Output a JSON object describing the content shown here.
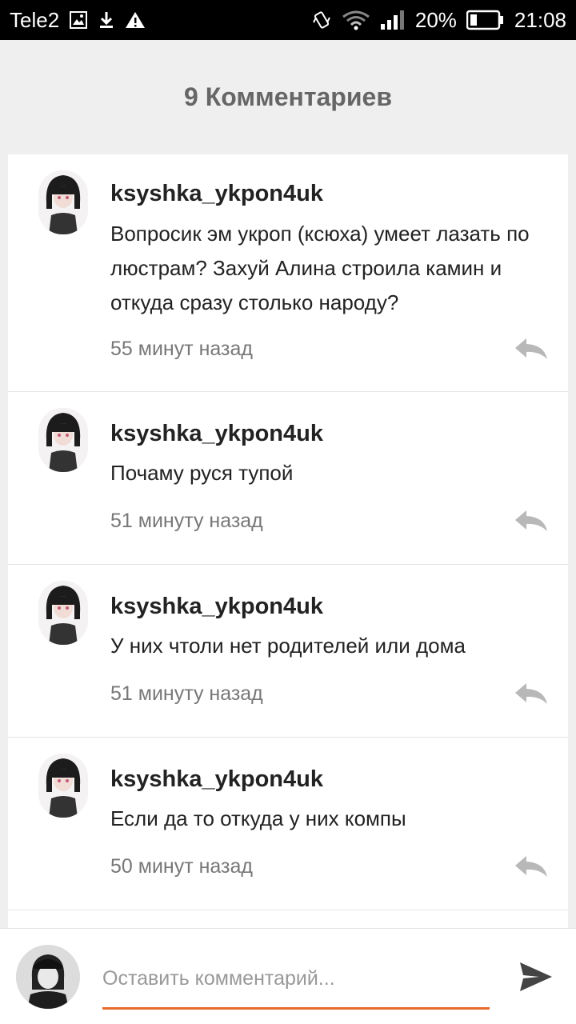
{
  "status_bar": {
    "carrier": "Tele2",
    "battery": "20%",
    "time": "21:08",
    "icons": [
      "image-icon",
      "download-icon",
      "warning-icon",
      "vibrate-icon",
      "wifi-icon",
      "signal-icon",
      "battery-icon"
    ]
  },
  "header": {
    "title": "9 Комментариев"
  },
  "comments": [
    {
      "author": "ksyshka_ykpon4uk",
      "text": "Вопросик эм укроп (ксюха) умеет лазать по люстрам? Захуй Алина строила камин и откуда сразу столько народу?",
      "time": "55 минут назад"
    },
    {
      "author": "ksyshka_ykpon4uk",
      "text": "Почаму руся тупой",
      "time": "51 минуту назад"
    },
    {
      "author": "ksyshka_ykpon4uk",
      "text": "У них чтоли нет родителей или дома",
      "time": "51 минуту назад"
    },
    {
      "author": "ksyshka_ykpon4uk",
      "text": "Если да то откуда у них компы",
      "time": "50 минут назад"
    }
  ],
  "composer": {
    "placeholder": "Оставить комментарий..."
  },
  "colors": {
    "accent": "#e8692b",
    "header_text": "#666666",
    "background": "#efefef"
  }
}
